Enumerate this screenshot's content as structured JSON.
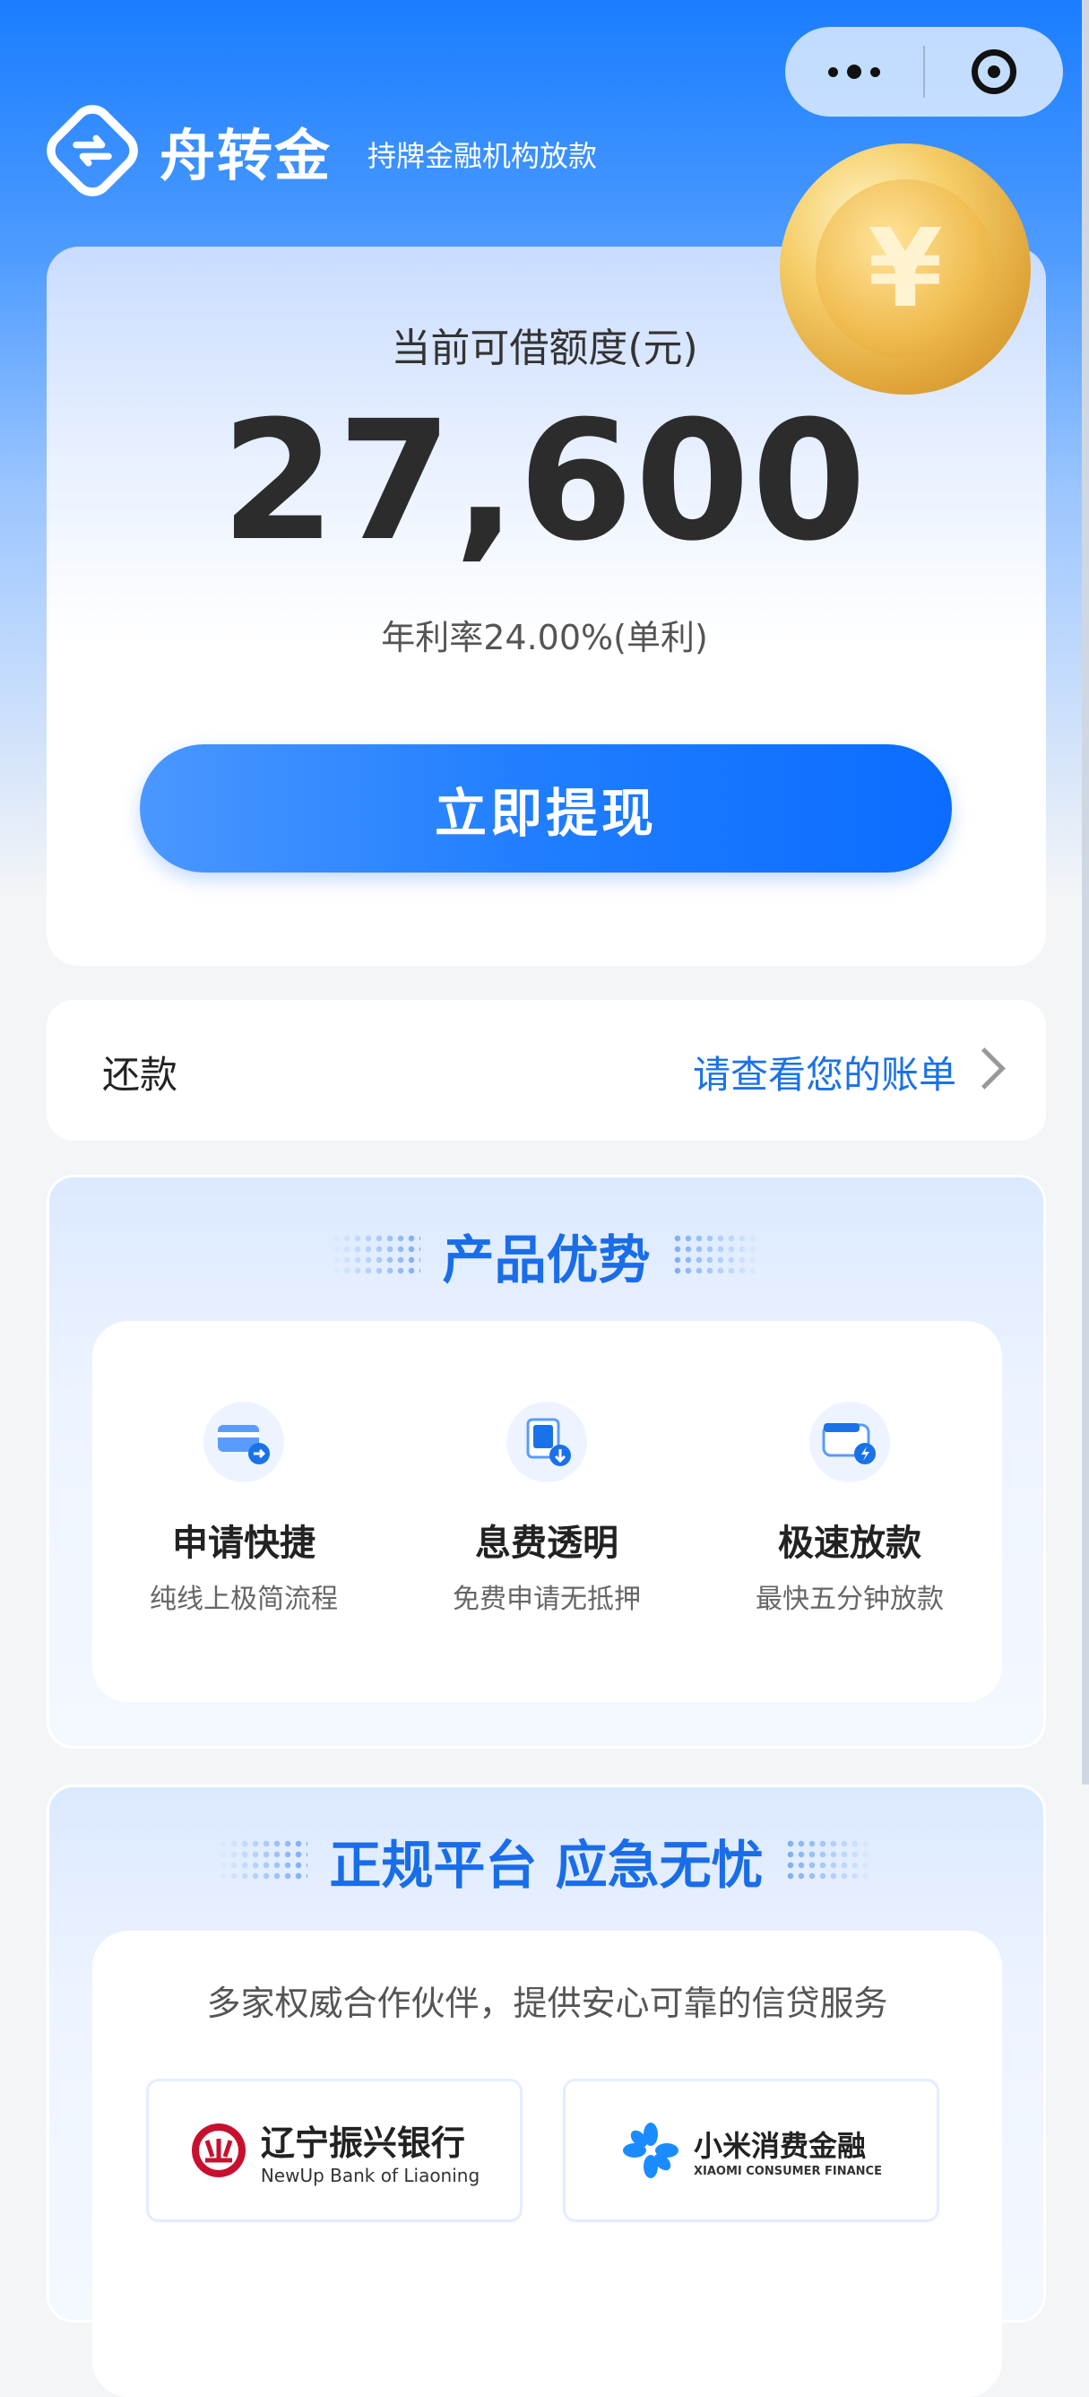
{
  "header": {
    "brand_name": "舟转金",
    "brand_tagline": "持牌金融机构放款",
    "menu_icon": "more-dots-icon",
    "close_icon": "target-circle-icon"
  },
  "credit": {
    "label": "当前可借额度(元)",
    "amount": "27,600",
    "rate": "年利率24.00%(单利)",
    "withdraw_label": "立即提现"
  },
  "repay": {
    "label": "还款",
    "link": "请查看您的账单"
  },
  "advantages": {
    "title": "产品优势",
    "items": [
      {
        "title": "申请快捷",
        "desc": "纯线上极简流程",
        "icon": "card-arrow-icon"
      },
      {
        "title": "息费透明",
        "desc": "免费申请无抵押",
        "icon": "document-download-icon"
      },
      {
        "title": "极速放款",
        "desc": "最快五分钟放款",
        "icon": "wallet-lightning-icon"
      }
    ]
  },
  "platform": {
    "title": "正规平台 应急无忧",
    "desc": "多家权威合作伙伴，提供安心可靠的信贷服务",
    "partners": [
      {
        "name": "辽宁振兴银行",
        "en": "NewUp Bank of Liaoning"
      },
      {
        "name": "小米消费金融",
        "en": "XIAOMI CONSUMER FINANCE"
      }
    ]
  },
  "colors": {
    "accent": "#1a72e8",
    "button": "#1f7dff"
  }
}
